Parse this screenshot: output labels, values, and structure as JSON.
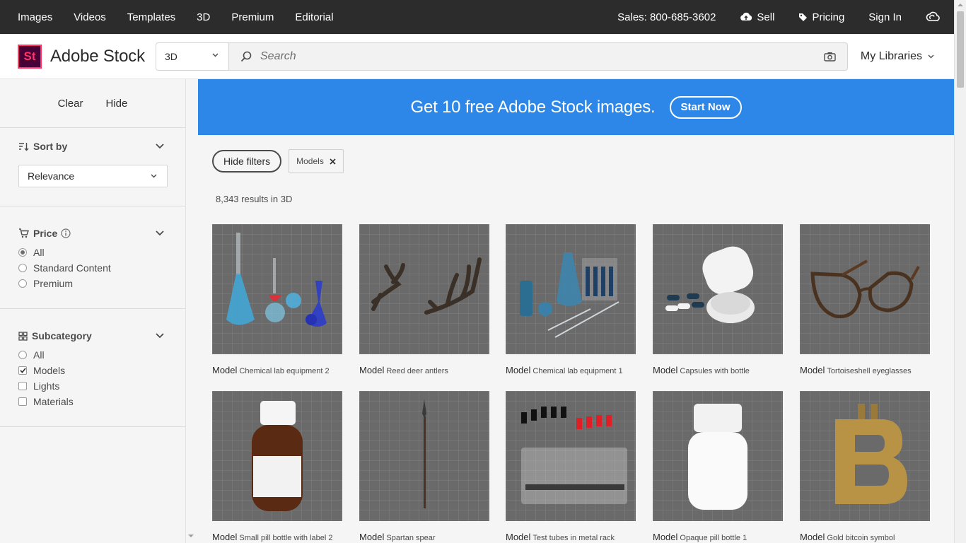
{
  "topnav": {
    "links": [
      "Images",
      "Videos",
      "Templates",
      "3D",
      "Premium",
      "Editorial"
    ],
    "sales": "Sales: 800-685-3602",
    "sell": "Sell",
    "pricing": "Pricing",
    "signin": "Sign In"
  },
  "header": {
    "logo_mark": "St",
    "logo_text": "Adobe Stock",
    "scope": "3D",
    "search_placeholder": "Search",
    "my_libraries": "My Libraries"
  },
  "sidebar": {
    "clear": "Clear",
    "hide": "Hide",
    "sort": {
      "title": "Sort by",
      "selected": "Relevance"
    },
    "price": {
      "title": "Price",
      "options": [
        "All",
        "Standard Content",
        "Premium"
      ],
      "selected": "All"
    },
    "subcategory": {
      "title": "Subcategory",
      "options": [
        "All",
        "Models",
        "Lights",
        "Materials"
      ],
      "checked": [
        "Models"
      ]
    }
  },
  "banner": {
    "text": "Get 10 free Adobe Stock images.",
    "button": "Start Now"
  },
  "filters": {
    "hide_button": "Hide filters",
    "chip": "Models"
  },
  "results": "8,343 results in 3D",
  "items": [
    {
      "type": "Model",
      "title": "Chemical lab equipment 2"
    },
    {
      "type": "Model",
      "title": "Reed deer antlers"
    },
    {
      "type": "Model",
      "title": "Chemical lab equipment 1"
    },
    {
      "type": "Model",
      "title": "Capsules with bottle"
    },
    {
      "type": "Model",
      "title": "Tortoiseshell eyeglasses"
    },
    {
      "type": "Model",
      "title": "Small pill bottle with label 2"
    },
    {
      "type": "Model",
      "title": "Spartan spear"
    },
    {
      "type": "Model",
      "title": "Test tubes in metal rack"
    },
    {
      "type": "Model",
      "title": "Opaque pill bottle 1"
    },
    {
      "type": "Model",
      "title": "Gold bitcoin symbol"
    }
  ]
}
